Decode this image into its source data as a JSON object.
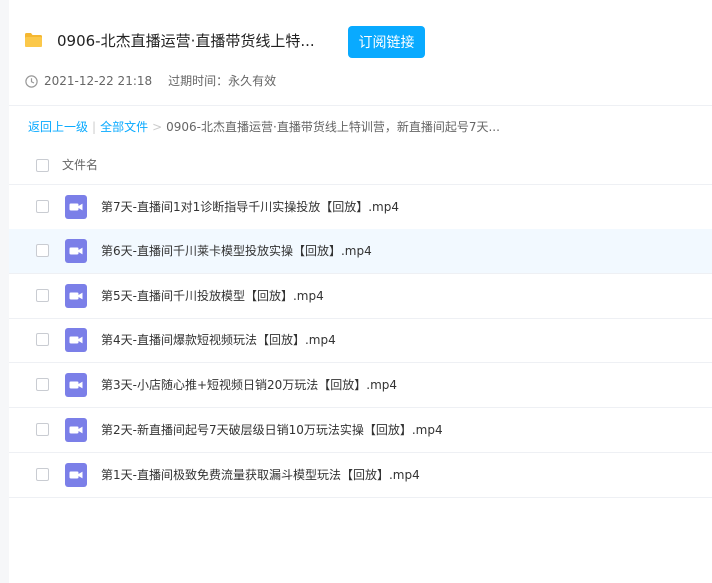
{
  "share": {
    "title": "0906-北杰直播运营·直播带货线上特...",
    "subscribe_label": "订阅链接",
    "date": "2021-12-22 21:18",
    "expire_label": "过期时间：永久有效"
  },
  "breadcrumb": {
    "back": "返回上一级",
    "all_files": "全部文件",
    "current": "0906-北杰直播运营·直播带货线上特训营，新直播间起号7天..."
  },
  "list": {
    "header": "文件名",
    "files": [
      {
        "name": "第7天-直播间1对1诊断指导千川实操投放【回放】.mp4"
      },
      {
        "name": "第6天-直播间千川莱卡模型投放实操【回放】.mp4"
      },
      {
        "name": "第5天-直播间千川投放模型【回放】.mp4"
      },
      {
        "name": "第4天-直播间爆款短视频玩法【回放】.mp4"
      },
      {
        "name": "第3天-小店随心推+短视频日销20万玩法【回放】.mp4"
      },
      {
        "name": "第2天-新直播间起号7天破层级日销10万玩法实操【回放】.mp4"
      },
      {
        "name": "第1天-直播间极致免费流量获取漏斗模型玩法【回放】.mp4"
      }
    ]
  },
  "colors": {
    "accent": "#09aaff",
    "folder": "#f5b731",
    "video_icon": "#7b7fe8",
    "hover_row": "#f2f9ff"
  },
  "icons": {
    "folder": "folder-icon",
    "clock": "clock-icon",
    "video": "video-file-icon"
  }
}
